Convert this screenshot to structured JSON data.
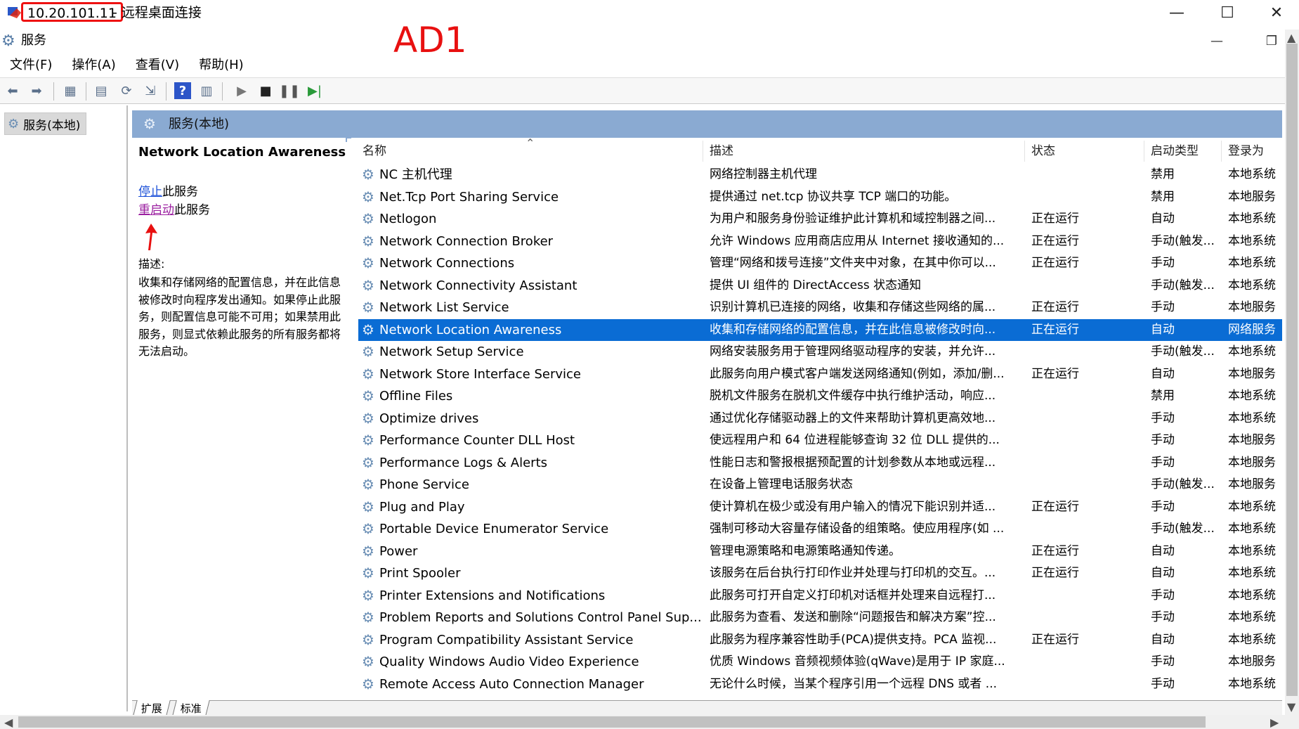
{
  "rdp": {
    "ip": "10.20.101.11",
    "title": "- 远程桌面连接",
    "minimize": "—",
    "maximize": "☐",
    "close": "✕"
  },
  "app": {
    "title": "服务",
    "annotation": "AD1",
    "restore_min": "—",
    "restore": "❐"
  },
  "menu": [
    "文件(F)",
    "操作(A)",
    "查看(V)",
    "帮助(H)"
  ],
  "tree": {
    "item": "服务(本地)"
  },
  "pane": {
    "header": "服务(本地)"
  },
  "detail": {
    "title": "Network Location Awareness",
    "stop_link": "停止",
    "stop_suffix": "此服务",
    "restart_link": "重启动",
    "restart_suffix": "此服务",
    "desc_label": "描述:",
    "desc_text": "收集和存储网络的配置信息，并在此信息被修改时向程序发出通知。如果停止此服务，则配置信息可能不可用；如果禁用此服务，则显式依赖此服务的所有服务都将无法启动。"
  },
  "columns": {
    "name": "名称",
    "desc": "描述",
    "status": "状态",
    "startup": "启动类型",
    "logon": "登录为"
  },
  "rows": [
    {
      "name": "NC 主机代理",
      "desc": "网络控制器主机代理",
      "status": "",
      "startup": "禁用",
      "logon": "本地系统"
    },
    {
      "name": "Net.Tcp Port Sharing Service",
      "desc": "提供通过 net.tcp 协议共享 TCP 端口的功能。",
      "status": "",
      "startup": "禁用",
      "logon": "本地服务"
    },
    {
      "name": "Netlogon",
      "desc": "为用户和服务身份验证维护此计算机和域控制器之间...",
      "status": "正在运行",
      "startup": "自动",
      "logon": "本地系统"
    },
    {
      "name": "Network Connection Broker",
      "desc": "允许 Windows 应用商店应用从 Internet 接收通知的...",
      "status": "正在运行",
      "startup": "手动(触发...",
      "logon": "本地系统"
    },
    {
      "name": "Network Connections",
      "desc": "管理“网络和拨号连接”文件夹中对象，在其中你可以...",
      "status": "正在运行",
      "startup": "手动",
      "logon": "本地系统"
    },
    {
      "name": "Network Connectivity Assistant",
      "desc": "提供 UI 组件的 DirectAccess 状态通知",
      "status": "",
      "startup": "手动(触发...",
      "logon": "本地系统"
    },
    {
      "name": "Network List Service",
      "desc": "识别计算机已连接的网络，收集和存储这些网络的属...",
      "status": "正在运行",
      "startup": "手动",
      "logon": "本地服务"
    },
    {
      "name": "Network Location Awareness",
      "desc": "收集和存储网络的配置信息，并在此信息被修改时向...",
      "status": "正在运行",
      "startup": "自动",
      "logon": "网络服务"
    },
    {
      "name": "Network Setup Service",
      "desc": "网络安装服务用于管理网络驱动程序的安装，并允许...",
      "status": "",
      "startup": "手动(触发...",
      "logon": "本地系统"
    },
    {
      "name": "Network Store Interface Service",
      "desc": "此服务向用户模式客户端发送网络通知(例如，添加/删...",
      "status": "正在运行",
      "startup": "自动",
      "logon": "本地服务"
    },
    {
      "name": "Offline Files",
      "desc": "脱机文件服务在脱机文件缓存中执行维护活动，响应...",
      "status": "",
      "startup": "禁用",
      "logon": "本地系统"
    },
    {
      "name": "Optimize drives",
      "desc": "通过优化存储驱动器上的文件来帮助计算机更高效地...",
      "status": "",
      "startup": "手动",
      "logon": "本地系统"
    },
    {
      "name": "Performance Counter DLL Host",
      "desc": "使远程用户和 64 位进程能够查询 32 位 DLL 提供的...",
      "status": "",
      "startup": "手动",
      "logon": "本地服务"
    },
    {
      "name": "Performance Logs & Alerts",
      "desc": "性能日志和警报根据预配置的计划参数从本地或远程...",
      "status": "",
      "startup": "手动",
      "logon": "本地服务"
    },
    {
      "name": "Phone Service",
      "desc": "在设备上管理电话服务状态",
      "status": "",
      "startup": "手动(触发...",
      "logon": "本地服务"
    },
    {
      "name": "Plug and Play",
      "desc": "使计算机在极少或没有用户输入的情况下能识别并适...",
      "status": "正在运行",
      "startup": "手动",
      "logon": "本地系统"
    },
    {
      "name": "Portable Device Enumerator Service",
      "desc": "强制可移动大容量存储设备的组策略。使应用程序(如 ...",
      "status": "",
      "startup": "手动(触发...",
      "logon": "本地系统"
    },
    {
      "name": "Power",
      "desc": "管理电源策略和电源策略通知传递。",
      "status": "正在运行",
      "startup": "自动",
      "logon": "本地系统"
    },
    {
      "name": "Print Spooler",
      "desc": "该服务在后台执行打印作业并处理与打印机的交互。...",
      "status": "正在运行",
      "startup": "自动",
      "logon": "本地系统"
    },
    {
      "name": "Printer Extensions and Notifications",
      "desc": "此服务可打开自定义打印机对话框并处理来自远程打...",
      "status": "",
      "startup": "手动",
      "logon": "本地系统"
    },
    {
      "name": "Problem Reports and Solutions Control Panel Sup...",
      "desc": "此服务为查看、发送和删除“问题报告和解决方案”控...",
      "status": "",
      "startup": "手动",
      "logon": "本地系统"
    },
    {
      "name": "Program Compatibility Assistant Service",
      "desc": "此服务为程序兼容性助手(PCA)提供支持。PCA 监视...",
      "status": "正在运行",
      "startup": "自动",
      "logon": "本地系统"
    },
    {
      "name": "Quality Windows Audio Video Experience",
      "desc": "优质 Windows 音频视频体验(qWave)是用于 IP 家庭...",
      "status": "",
      "startup": "手动",
      "logon": "本地服务"
    },
    {
      "name": "Remote Access Auto Connection Manager",
      "desc": "无论什么时候，当某个程序引用一个远程 DNS 或者 ...",
      "status": "",
      "startup": "手动",
      "logon": "本地系统"
    }
  ],
  "selected_index": 7,
  "tabs": [
    "扩展",
    "标准"
  ]
}
